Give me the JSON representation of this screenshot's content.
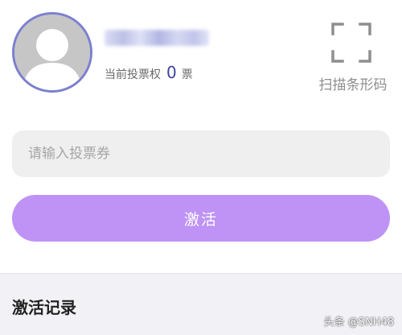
{
  "profile": {
    "avatar_icon": "default-user-avatar-icon",
    "votes_label": "当前投票权",
    "votes_count": "0",
    "votes_unit": "票"
  },
  "scan": {
    "icon": "scan-frame-icon",
    "label": "扫描条形码"
  },
  "voucher": {
    "placeholder": "请输入投票券",
    "value": ""
  },
  "activate": {
    "label": "激活"
  },
  "records": {
    "title": "激活记录"
  },
  "watermark": {
    "text": "头条 @SNH48"
  },
  "colors": {
    "accent": "#bf93f6",
    "avatar_ring": "#7d7fd0",
    "vote_count": "#3e42a0",
    "input_bg": "#efefef",
    "records_bg": "#f2f2f6"
  }
}
